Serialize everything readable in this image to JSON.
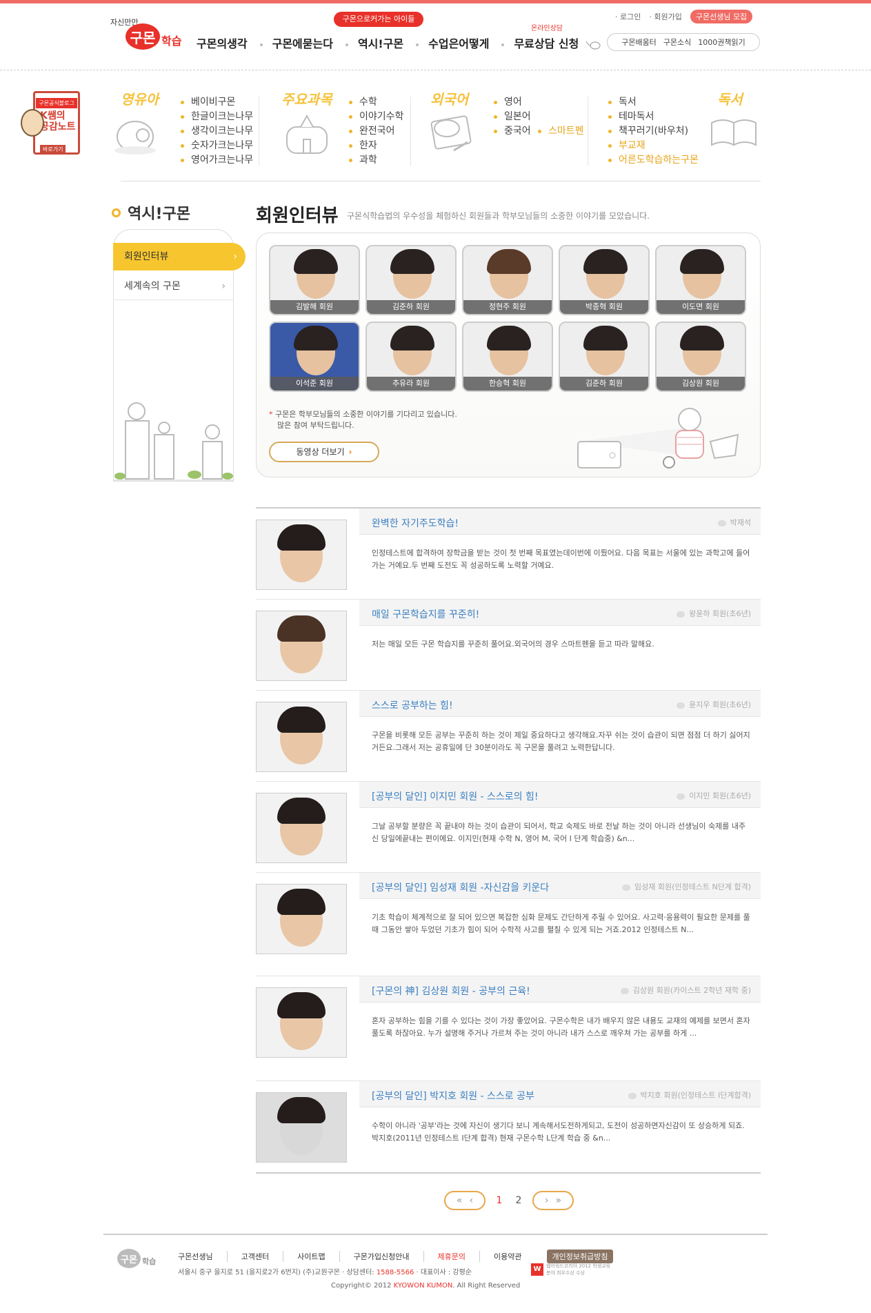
{
  "header": {
    "logo": {
      "small": "자신만만",
      "badge": "구몬",
      "text": "학습"
    },
    "nav": [
      "구몬의생각",
      "구몬에묻는다",
      "역시!구몬",
      "수업은어떻게",
      "무료상담 신청"
    ],
    "nav_bubble": "구몬으로커가는 아이들",
    "nav_bubble2": "온라인상담",
    "util": {
      "login": "· 로그인",
      "join": "· 회원가입",
      "recruit": "구몬선생님 모집"
    },
    "util2": [
      "구몬배움터",
      "구몬소식",
      "1000권책읽기"
    ]
  },
  "banner": {
    "tag": "구몬공식블로그",
    "k": "K쌤의 공감노트",
    "go": "바로가기"
  },
  "categories": [
    {
      "title": "영유아",
      "items": [
        "베이비구몬",
        "한글이크는나무",
        "생각이크는나무",
        "숫자가크는나무",
        "영어가크는나무"
      ],
      "hl": []
    },
    {
      "title": "주요과목",
      "items": [
        "수학",
        "이야기수학",
        "완전국어",
        "한자",
        "과학"
      ],
      "hl": []
    },
    {
      "title": "외국어",
      "items": [
        "영어",
        "일본어",
        "중국어",
        "스마트펜"
      ],
      "hl": [
        3
      ]
    },
    {
      "title": "독서",
      "items": [
        "독서",
        "테마독서",
        "책꾸러기(바우처)",
        "부교재",
        "어른도학습하는구몬"
      ],
      "hl": [
        3,
        4
      ]
    }
  ],
  "lnb": {
    "title": "역시!구몬",
    "items": [
      "회원인터뷰",
      "세계속의 구몬"
    ]
  },
  "main": {
    "title": "회원인터뷰",
    "desc": "구몬식학습법의 우수성을 체험하신 회원들과 학부모님들의 소중한 이야기를 모았습니다.",
    "gallery": [
      "김발해 회원",
      "김준하 회원",
      "정현주 회원",
      "박종혁 회원",
      "이도면 회원",
      "이석준 회원",
      "추유라 회원",
      "한승혁 회원",
      "김준하 회원",
      "김상원 회원"
    ],
    "note1": "구몬은 학부모님들의 소중한 이야기를 기다리고 있습니다.",
    "note2": "많은 참여 부탁드립니다.",
    "video_btn": "동영상 더보기"
  },
  "interviews": [
    {
      "title": "완벽한 자기주도학습!",
      "author": "박재석",
      "body": "인정테스트에 합격하여 장학금을 받는 것이 첫 번째 목표였는데이번에 이뤘어요. 다음 목표는 서울에 있는 과학고에 들어가는 거예요.두 번째 도전도 꼭 성공하도록 노력할 거예요."
    },
    {
      "title": "매일 구몬학습지를 꾸준히!",
      "author": "왕윤하 회원(초6년)",
      "body": "저는 매일 모든 구몬 학습지를 꾸준히 풀어요.외국어의 경우 스마트펜을 듣고 따라 말해요."
    },
    {
      "title": "스스로 공부하는 힘!",
      "author": "윤지우 회원(초6년)",
      "body": "구몬을 비롯해 모든 공부는 꾸준히 하는 것이 제일 중요하다고 생각해요.자꾸 쉬는 것이 습관이 되면 점점 더 하기 싫어지거든요.그래서 저는 공휴일에 단 30분이라도 꼭 구몬을 풀려고 노력한답니다."
    },
    {
      "title": "[공부의 달인] 이지민 회원 - 스스로의 힘!",
      "author": "이지민 회원(초6년)",
      "body": "그날 공부할 분량은 꼭 끝내야 하는 것이 습관이 되어서, 학교 숙제도 바로 전날 하는 것이 아니라 선생님이 숙제를 내주신 당일에끝내는 편이에요. 이지민(현재 수학 N, 영어 M, 국어 I 단계 학습중)   &n..."
    },
    {
      "title": "[공부의 달인] 임성재 회원 -자신감을 키운다",
      "author": "임성재 회원(인정테스트 N단계 합격)",
      "body": "기초 학습이 체계적으로 잘 되어 있으면 복잡한 심화 문제도 간단하게 추릴 수 있어요. 사고력·응용력이 필요한 문제를 풀 때 그동안 쌓아 두었던 기초가 힘이 되어 수학적 사고를 펼칠 수 있게 되는 거죠.2012 인정테스트 N..."
    },
    {
      "title": "[구몬의 神] 김상원 회원 - 공부의 근육!",
      "author": "김상원 회원(카이스트 2학년 재학 중)",
      "body": "혼자 공부하는 힘을 기를 수 있다는 것이 가장 좋았어요. 구몬수학은 내가 배우지 않은 내용도 교재의 예제를 보면서 혼자 풀도록 하잖아요. 누가 설명해 주거나 가르쳐 주는 것이 아니라 내가 스스로 깨우쳐 가는 공부를 하게 ..."
    },
    {
      "title": "[공부의 달인] 박지호 회원 - 스스로 공부",
      "author": "박지호 회원(인정테스트 I단계합격)",
      "body": "수학이 아니라 '공부'라는 것에 자신이 생기다 보니 계속해서도전하게되고, 도전이 성공하면자신감이 또 상승하게 되죠. 박지호(2011년 인정테스트 I단계 합격) 현재 구몬수학 L단계 학습 중   &n..."
    }
  ],
  "pager": {
    "first": "«",
    "prev": "‹",
    "pages": [
      "1",
      "2"
    ],
    "current": "1",
    "next": "›",
    "last": "»"
  },
  "footer": {
    "logo_badge": "구몬",
    "logo_text": "학습",
    "links": [
      "구몬선생님",
      "고객센터",
      "사이트맵",
      "구몬가입신청안내",
      "제휴문의",
      "이용약관",
      "개인정보취급방침"
    ],
    "addr_pre": "서울시 중구 을지로 51 (을지로2가 6번지) (주)교원구몬  ·  상담센터: ",
    "phone": "1588-5566",
    "addr_post": "  ·  대표이사 : 강평순",
    "award": "웹어워드코리아 2012 학생교육분야 최우수상 수상",
    "copy_pre": "Copyright© 2012 ",
    "copy_brand": "KYOWON KUMON",
    "copy_post": ". All Right Reserved"
  },
  "colors": {
    "accent": "#e8312a",
    "yellow": "#f7c62e",
    "link_blue": "#3a7fc0"
  }
}
